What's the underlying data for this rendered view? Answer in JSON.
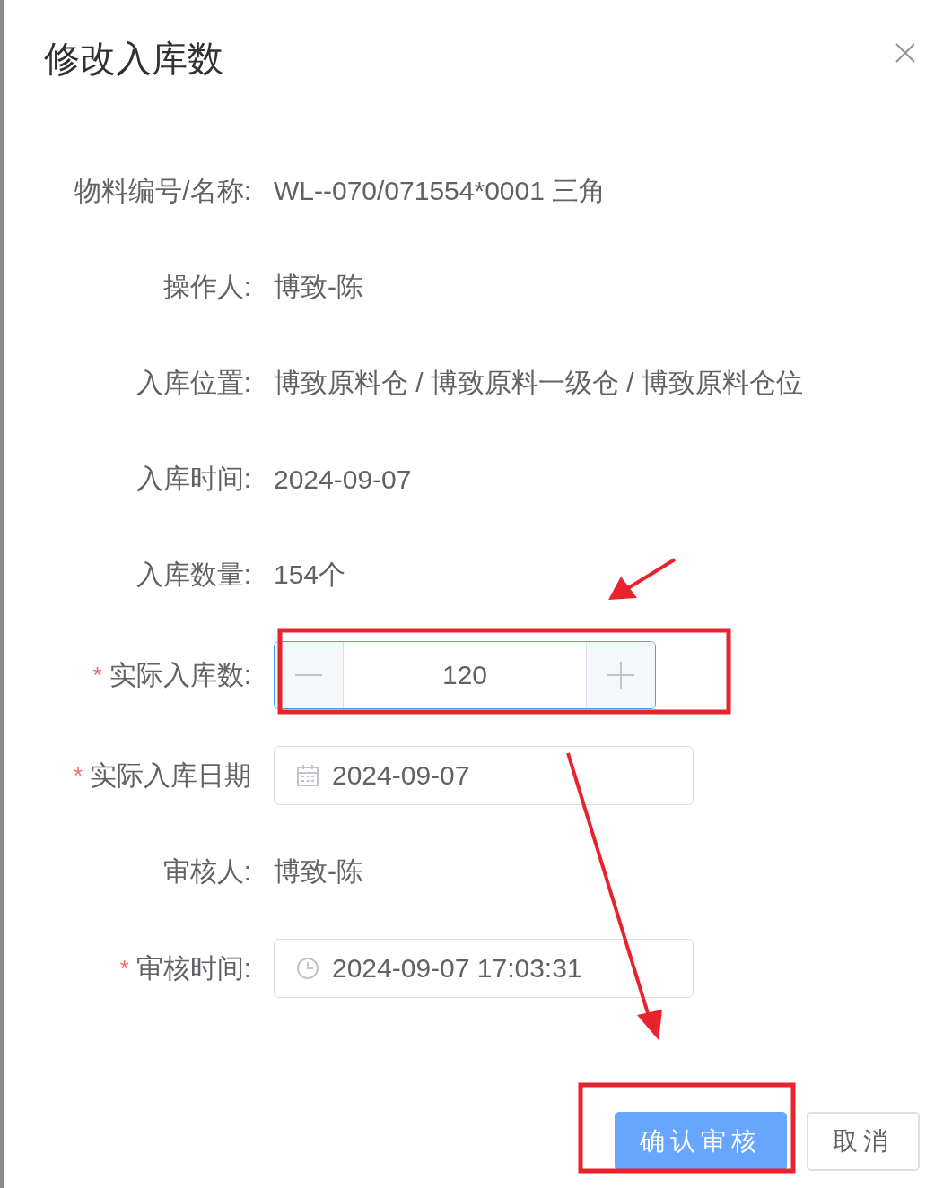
{
  "dialog": {
    "title": "修改入库数"
  },
  "fields": [
    {
      "label": "物料编号/名称:",
      "kind": "text",
      "value": "WL--070/071554*0001 三角"
    },
    {
      "label": "操作人:",
      "kind": "text",
      "value": "博致-陈"
    },
    {
      "label": "入库位置:",
      "kind": "text",
      "value": "博致原料仓 / 博致原料一级仓 / 博致原料仓位"
    },
    {
      "label": "入库时间:",
      "kind": "text",
      "value": "2024-09-07"
    },
    {
      "label": "入库数量:",
      "kind": "text",
      "value": "154个"
    },
    {
      "label": "实际入库数:",
      "kind": "number",
      "marker": "*",
      "value": "120",
      "focused": true
    },
    {
      "label": "实际入库日期",
      "kind": "date",
      "marker": "*",
      "value": "2024-09-07"
    },
    {
      "label": "审核人:",
      "kind": "text",
      "value": "博致-陈"
    },
    {
      "label": "审核时间:",
      "kind": "datetime",
      "marker": "*",
      "value": "2024-09-07 17:03:31"
    }
  ],
  "buttons": [
    {
      "label": "确认审核",
      "kind": "primary"
    },
    {
      "label": "取消",
      "kind": "default"
    }
  ]
}
